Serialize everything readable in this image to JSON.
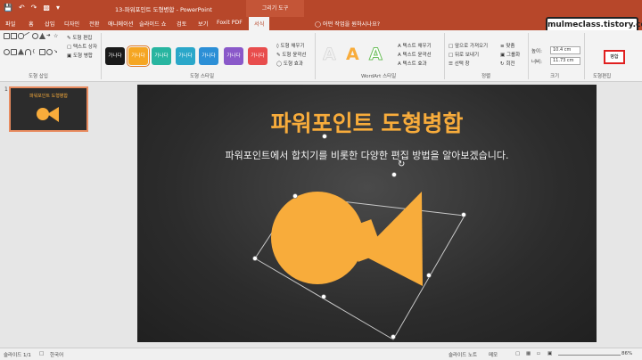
{
  "titlebar": {
    "doc_title": "13-파워포인트 도형병합 - PowerPoint",
    "context_tab": "그리기 도구"
  },
  "tabs": [
    "파일",
    "홈",
    "삽입",
    "디자인",
    "전환",
    "애니메이션",
    "슬라이드 쇼",
    "검토",
    "보기",
    "Foxit PDF",
    "서식"
  ],
  "search_hint": "어떤 작업을 원하시나요?",
  "watermark": "mulmeclass.tistory.com",
  "ribbon": {
    "insert_shapes": {
      "edit_shape": "도형 편집",
      "text_box": "텍스트 상자",
      "merge_shapes": "도형 병합",
      "label": "도형 삽입"
    },
    "shape_styles": {
      "swatch_text": "가나다",
      "fill": "도형 채우기",
      "outline": "도형 윤곽선",
      "effects": "도형 효과",
      "label": "도형 스타일",
      "swatch_colors": [
        "#1a1a1a",
        "#f5a623",
        "#28b5a0",
        "#2ba7c9",
        "#2c8fd6",
        "#8a59c9",
        "#e84d4d"
      ]
    },
    "wordart": {
      "glyph": "A",
      "text_fill": "텍스트 채우기",
      "text_outline": "텍스트 윤곽선",
      "text_effects": "텍스트 효과",
      "label": "WordArt 스타일"
    },
    "arrange": {
      "bring_forward": "앞으로 가져오기",
      "send_backward": "뒤로 보내기",
      "selection_pane": "선택 창",
      "align": "맞춤",
      "group": "그룹화",
      "rotate": "회전",
      "label": "정렬"
    },
    "size": {
      "height_label": "높이:",
      "height_value": "10.4 cm",
      "width_label": "너비:",
      "width_value": "11.73 cm",
      "label": "크기"
    },
    "merge": {
      "button": "병합",
      "label": "도형편집"
    }
  },
  "slide_panel": {
    "number": "1",
    "thumb_title": "파워포인트 도형병합"
  },
  "slide": {
    "title": "파워포인트 도형병합",
    "subtitle": "파워포인트에서 합치기를 비롯한 다양한 편집 방법을 알아보겠습니다.",
    "shape_color": "#f8ac3b",
    "title_color": "#f8ac3b"
  },
  "statusbar": {
    "slide_info": "슬라이드 1/1",
    "language": "한국어",
    "notes": "슬라이드 노트",
    "comments": "메모",
    "zoom": "86%"
  }
}
